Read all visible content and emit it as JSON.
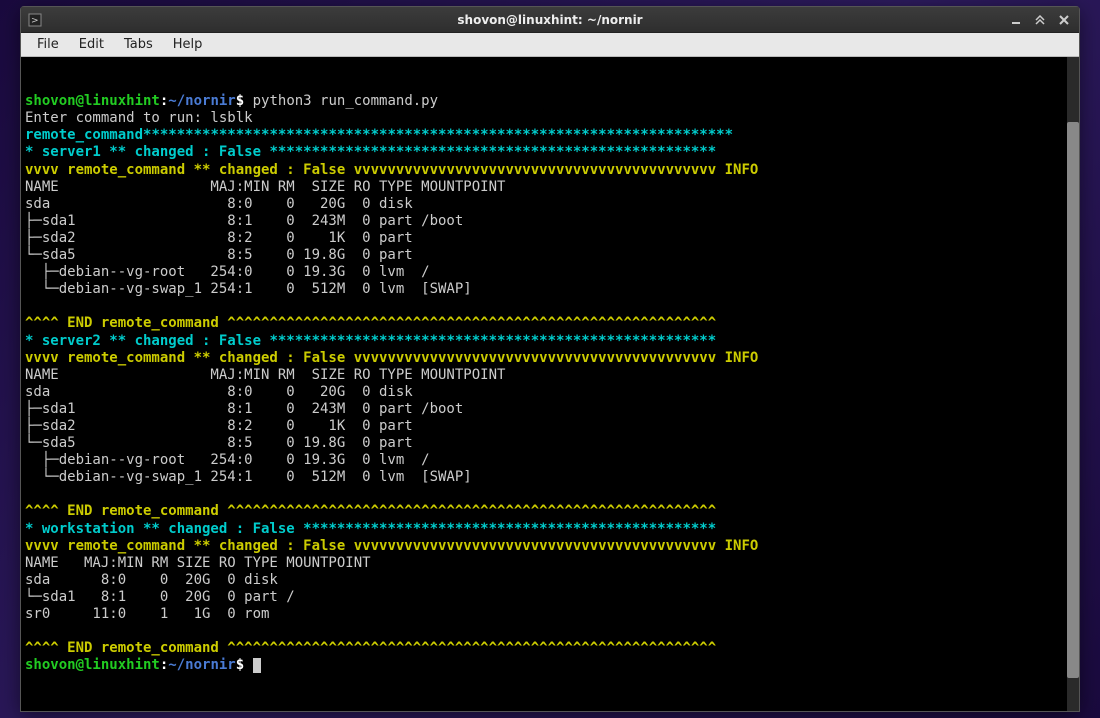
{
  "window": {
    "title": "shovon@linuxhint: ~/nornir"
  },
  "menubar": {
    "items": [
      "File",
      "Edit",
      "Tabs",
      "Help"
    ]
  },
  "prompt": {
    "user_host": "shovon@linuxhint",
    "sep": ":",
    "path": "~/nornir",
    "dollar": "$"
  },
  "input": {
    "cmd1": " python3 run_command.py",
    "line2": "Enter command to run: lsblk"
  },
  "divider": {
    "task_label": "remote_command",
    "task_stars": "**********************************************************************",
    "srv1_label": "* server1 ** changed : False ",
    "srv1_stars": "*****************************************************",
    "vv_label": "vvvv remote_command ** changed : False ",
    "vv_v": "vvvvvvvvvvvvvvvvvvvvvvvvvvvvvvvvvvvvvvvvvvv",
    "info": " INFO",
    "end_label": "^^^^ END remote_command ",
    "end_carets": "^^^^^^^^^^^^^^^^^^^^^^^^^^^^^^^^^^^^^^^^^^^^^^^^^^^^^^^^^^",
    "srv2_label": "* server2 ** changed : False ",
    "srv2_stars": "*****************************************************",
    "ws_label": "* workstation ** changed : False ",
    "ws_stars": "*************************************************"
  },
  "lsblk": {
    "header": "NAME                  MAJ:MIN RM  SIZE RO TYPE MOUNTPOINT",
    "rows": [
      "sda                     8:0    0   20G  0 disk ",
      "├─sda1                  8:1    0  243M  0 part /boot",
      "├─sda2                  8:2    0    1K  0 part ",
      "└─sda5                  8:5    0 19.8G  0 part ",
      "  ├─debian--vg-root   254:0    0 19.3G  0 lvm  /",
      "  └─debian--vg-swap_1 254:1    0  512M  0 lvm  [SWAP]"
    ]
  },
  "lsblk_ws": {
    "header": "NAME   MAJ:MIN RM SIZE RO TYPE MOUNTPOINT",
    "rows": [
      "sda      8:0    0  20G  0 disk ",
      "└─sda1   8:1    0  20G  0 part /",
      "sr0     11:0    1   1G  0 rom  "
    ]
  }
}
